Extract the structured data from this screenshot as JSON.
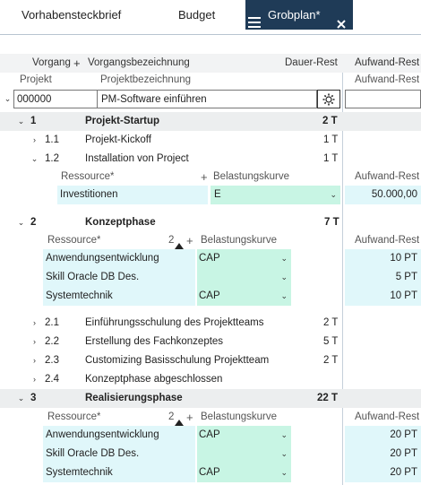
{
  "tabs": [
    {
      "label": "Vorhabensteckbrief"
    },
    {
      "label": "Budget"
    },
    {
      "label": "Grobplan*"
    }
  ],
  "colheaders": {
    "vorgang": "Vorgang",
    "plus": "+",
    "bez": "Vorgangsbezeichnung",
    "dauer": "Dauer-Rest",
    "aufwand": "Aufwand-Rest"
  },
  "projhdr": {
    "projekt": "Projekt",
    "bez": "Projektbezeichnung",
    "aufwand": "Aufwand-Rest"
  },
  "project": {
    "id": "000000",
    "name": "PM-Software einführen"
  },
  "phase1": {
    "num": "1",
    "name": "Projekt-Startup",
    "dur": "2 T"
  },
  "t11": {
    "num": "1.1",
    "name": "Projekt-Kickoff",
    "dur": "1 T"
  },
  "t12": {
    "num": "1.2",
    "name": "Installation von Project",
    "dur": "1 T"
  },
  "res12": {
    "hdr_res": "Ressource*",
    "plus": "+",
    "hdr_kurve": "Belastungskurve",
    "hdr_aufwand": "Aufwand-Rest",
    "rows": [
      {
        "res": "Investitionen",
        "kurve": "E",
        "aufwand": "50.000,00"
      }
    ]
  },
  "phase2": {
    "num": "2",
    "name": "Konzeptphase",
    "dur": "7 T"
  },
  "res2": {
    "hdr_res": "Ressource*",
    "sort": "2",
    "plus": "+",
    "hdr_kurve": "Belastungskurve",
    "hdr_aufwand": "Aufwand-Rest",
    "rows": [
      {
        "res": "Anwendungsentwicklung",
        "kurve": "CAP",
        "aufwand": "10 PT"
      },
      {
        "res": "Skill Oracle DB Des.",
        "kurve": "",
        "aufwand": "5 PT"
      },
      {
        "res": "Systemtechnik",
        "kurve": "CAP",
        "aufwand": "10 PT"
      }
    ]
  },
  "t21": {
    "num": "2.1",
    "name": "Einführungsschulung des Projektteams",
    "dur": "2 T"
  },
  "t22": {
    "num": "2.2",
    "name": "Erstellung des Fachkonzeptes",
    "dur": "5 T"
  },
  "t23": {
    "num": "2.3",
    "name": "Customizing Basisschulung Projektteam",
    "dur": "2 T"
  },
  "t24": {
    "num": "2.4",
    "name": "Konzeptphase abgeschlossen",
    "dur": ""
  },
  "phase3": {
    "num": "3",
    "name": "Realisierungsphase",
    "dur": "22 T"
  },
  "res3": {
    "hdr_res": "Ressource*",
    "sort": "2",
    "plus": "+",
    "hdr_kurve": "Belastungskurve",
    "hdr_aufwand": "Aufwand-Rest",
    "rows": [
      {
        "res": "Anwendungsentwicklung",
        "kurve": "CAP",
        "aufwand": "20 PT"
      },
      {
        "res": "Skill Oracle DB Des.",
        "kurve": "",
        "aufwand": "20 PT"
      },
      {
        "res": "Systemtechnik",
        "kurve": "CAP",
        "aufwand": "20 PT"
      }
    ]
  },
  "colors": {
    "tab_active": "#1f3b57",
    "cyan": "#e0f7fa",
    "mint": "#c8f5e4"
  },
  "icons": [
    "menu-icon",
    "close-icon",
    "gear-icon",
    "chevron-down-icon",
    "chevron-right-icon",
    "sort-up-icon"
  ]
}
